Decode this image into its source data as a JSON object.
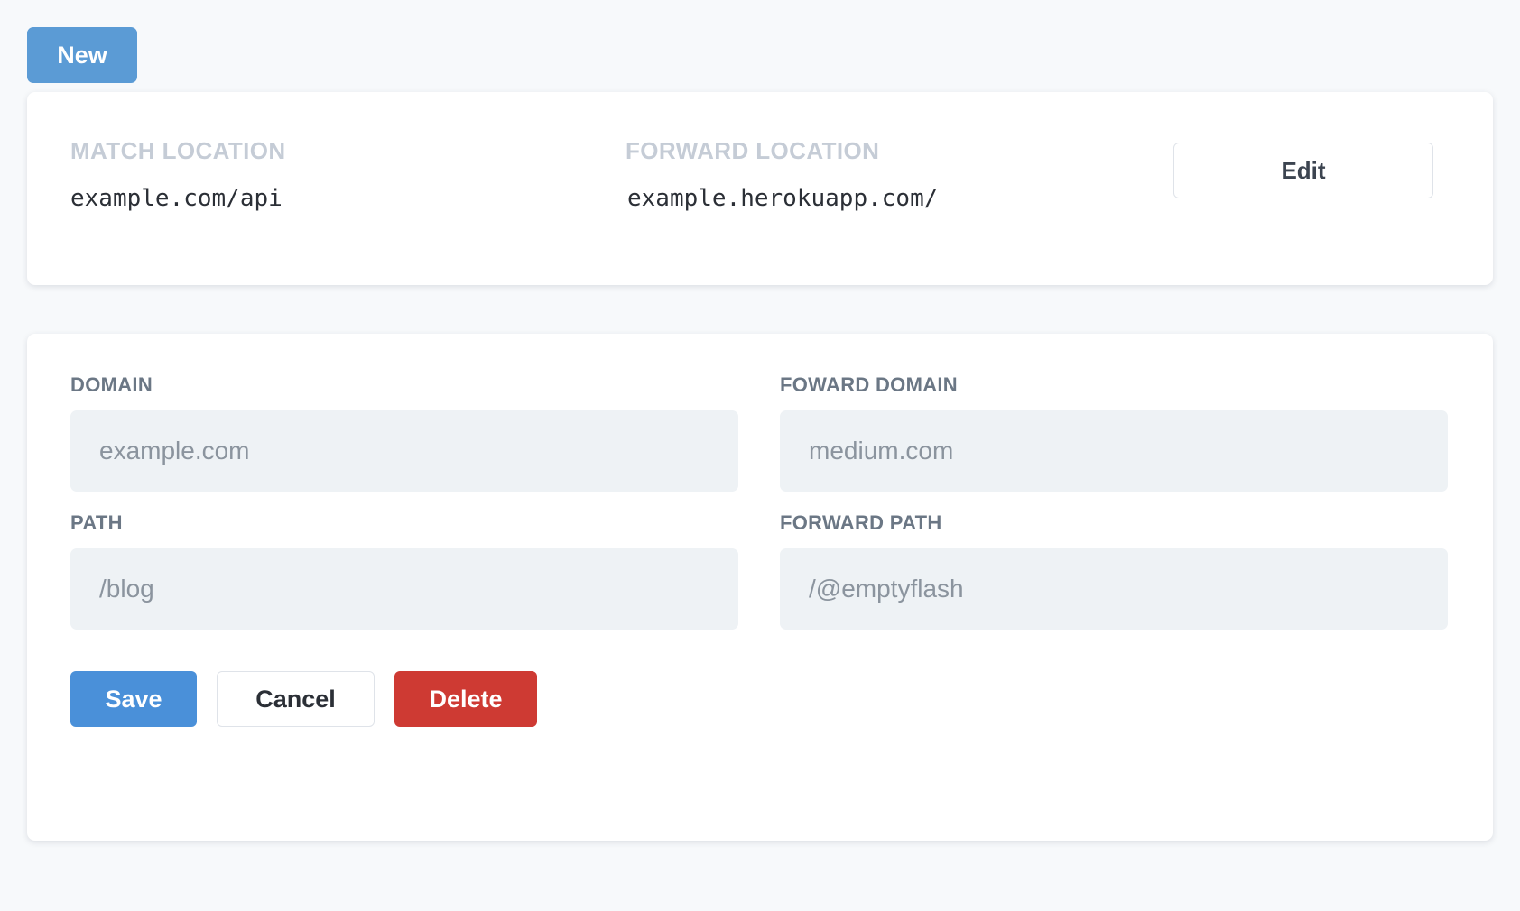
{
  "theme": {
    "page_background": "#f7f9fb",
    "card_background": "#ffffff",
    "primary_blue": "#4a90d9",
    "new_button_blue": "#5b9bd5",
    "danger_red": "#ce3a33",
    "input_background": "#eef2f5",
    "muted_label": "#c5ccd6",
    "field_label": "#6b7785"
  },
  "toolbar": {
    "new_label": "New"
  },
  "summary": {
    "match_location_label": "MATCH LOCATION",
    "match_location_value": "example.com/api",
    "forward_location_label": "FORWARD LOCATION",
    "forward_location_value": "example.herokuapp.com/",
    "edit_label": "Edit"
  },
  "form": {
    "fields": [
      {
        "label": "DOMAIN",
        "value": "",
        "placeholder": "example.com"
      },
      {
        "label": "FOWARD DOMAIN",
        "value": "",
        "placeholder": "medium.com"
      },
      {
        "label": "PATH",
        "value": "",
        "placeholder": "/blog"
      },
      {
        "label": "FORWARD PATH",
        "value": "",
        "placeholder": "/@emptyflash"
      }
    ],
    "actions": {
      "save_label": "Save",
      "cancel_label": "Cancel",
      "delete_label": "Delete"
    }
  }
}
